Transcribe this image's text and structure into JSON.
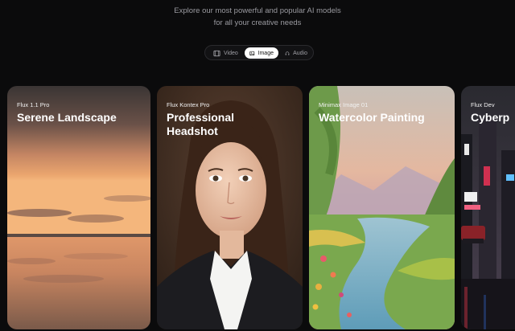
{
  "header": {
    "subtitle_line1": "Explore our most powerful and popular AI models",
    "subtitle_line2": "for all your creative needs"
  },
  "tabs": [
    {
      "label": "Video",
      "icon": "film-icon",
      "active": false
    },
    {
      "label": "Image",
      "icon": "image-icon",
      "active": true
    },
    {
      "label": "Audio",
      "icon": "headphones-icon",
      "active": false
    }
  ],
  "cards": [
    {
      "model": "Flux 1.1 Pro",
      "title": "Serene Landscape"
    },
    {
      "model": "Flux Kontex Pro",
      "title": "Professional Headshot"
    },
    {
      "model": "Minimax Image 01",
      "title": "Watercolor Painting"
    },
    {
      "model": "Flux Dev",
      "title": "Cyberp"
    }
  ],
  "colors": {
    "background": "#0b0b0c",
    "active_tab": "#ffffff"
  }
}
